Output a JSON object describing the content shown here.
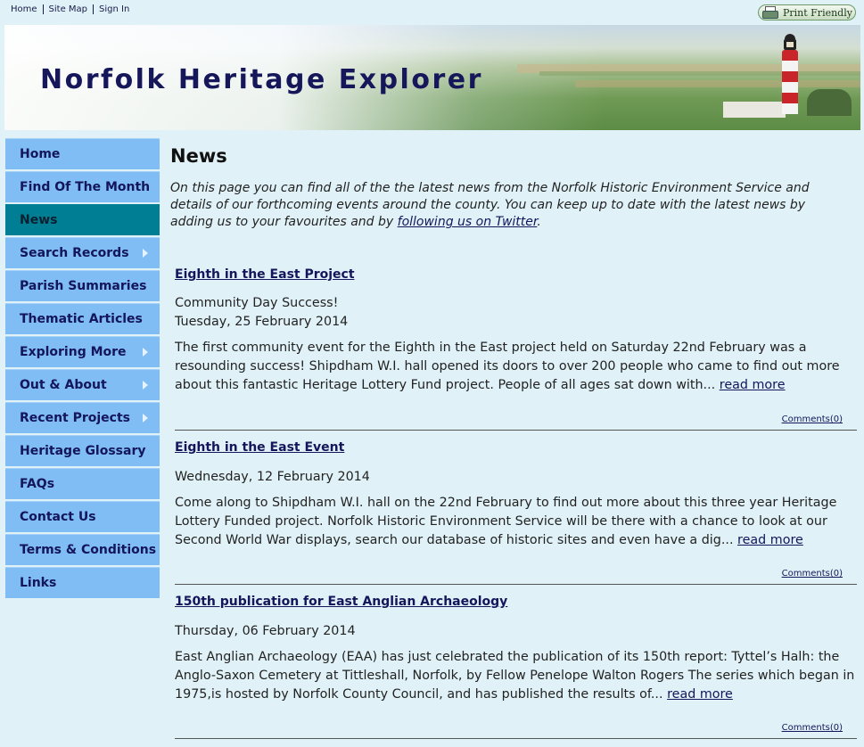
{
  "topnav": {
    "home": "Home",
    "sitemap": "Site Map",
    "signin": "Sign In"
  },
  "print_button": {
    "label": "Print Friendly",
    "icon": "printer-icon"
  },
  "banner": {
    "title": "Norfolk Heritage Explorer"
  },
  "sidebar": {
    "items": [
      {
        "label": "Home",
        "submenu": false,
        "active": false
      },
      {
        "label": "Find Of The Month",
        "submenu": false,
        "active": false
      },
      {
        "label": "News",
        "submenu": false,
        "active": true
      },
      {
        "label": "Search Records",
        "submenu": true,
        "active": false
      },
      {
        "label": "Parish Summaries",
        "submenu": false,
        "active": false
      },
      {
        "label": "Thematic Articles",
        "submenu": false,
        "active": false
      },
      {
        "label": "Exploring More",
        "submenu": true,
        "active": false
      },
      {
        "label": "Out & About",
        "submenu": true,
        "active": false
      },
      {
        "label": "Recent Projects",
        "submenu": true,
        "active": false
      },
      {
        "label": "Heritage Glossary",
        "submenu": false,
        "active": false
      },
      {
        "label": "FAQs",
        "submenu": false,
        "active": false
      },
      {
        "label": "Contact Us",
        "submenu": false,
        "active": false
      },
      {
        "label": "Terms & Conditions",
        "submenu": false,
        "active": false
      },
      {
        "label": "Links",
        "submenu": false,
        "active": false
      }
    ]
  },
  "page": {
    "title": "News",
    "intro_text": "On this page you can find all of the the latest news from the Norfolk Historic Environment Service and details of our forthcoming events around the county. You can keep up to date with the latest news by adding us to your favourites and by ",
    "intro_link": "following us on Twitter",
    "intro_end": "."
  },
  "articles": [
    {
      "title": "Eighth in the East Project",
      "subtitle": "Community Day Success!",
      "date": "Tuesday, 25 February 2014",
      "body": "The first community event for the Eighth in the East project held on Saturday 22nd February was a resounding success! Shipdham W.I. hall opened its doors to over 200 people who came to find out more about this fantastic Heritage Lottery Fund project. People of all ages sat down with... ",
      "read_more": "read more",
      "comments": "Comments(0)"
    },
    {
      "title": "Eighth in the East Event",
      "subtitle": "",
      "date": "Wednesday, 12 February 2014",
      "body": "Come along to Shipdham W.I. hall on the 22nd February to find out more about this three year Heritage Lottery Funded project. Norfolk Historic Environment Service will be there with a chance to look at our Second World War displays, search our database of historic sites and even have a dig... ",
      "read_more": "read more",
      "comments": "Comments(0)"
    },
    {
      "title": "150th publication for East Anglian Archaeology",
      "subtitle": "",
      "date": "Thursday, 06 February 2014",
      "body": "East Anglian Archaeology (EAA) has just celebrated the publication of its 150th report: Tyttel’s Halh: the Anglo-Saxon Cemetery at Tittleshall, Norfolk, by Fellow Penelope Walton Rogers The series which began in 1975,is hosted by Norfolk County Council, and has published the results of... ",
      "read_more": "read more",
      "comments": "Comments(0)"
    }
  ],
  "colors": {
    "background": "#e0f2f8",
    "nav_item": "#7fbdf4",
    "nav_active": "#007e93",
    "title_text": "#16175a"
  }
}
